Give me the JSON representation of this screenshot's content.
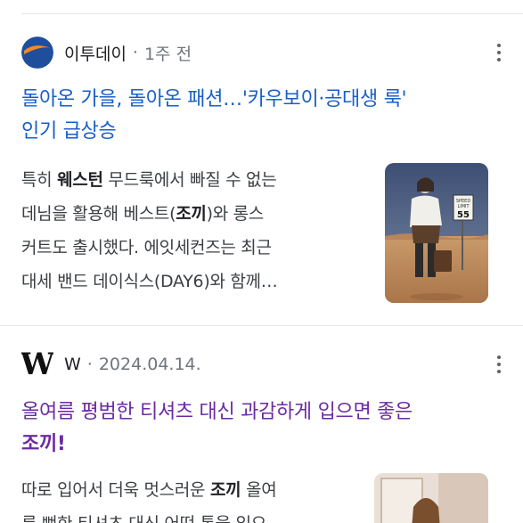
{
  "results": [
    {
      "source": {
        "name": "이투데이",
        "time": "1주 전",
        "logo_icon": "etoday-logo-icon"
      },
      "title_lines": [
        "돌아온 가을, 돌아온 패션…'카우보이·공대생 룩'",
        "인기 급상승"
      ],
      "snippet": {
        "l1_a": "특히 ",
        "l1_b": "웨스턴",
        "l1_c": " 무드룩에서 빠질 수 없는",
        "l2_a": "데님을 활용해 베스트(",
        "l2_b": "조끼",
        "l2_c": ")와 롱스",
        "l3": "커트도 출시했다. 에잇세컨즈는 최근",
        "l4": "대세 밴드 데이식스(DAY6)와 함께…"
      },
      "thumbnail": {
        "sign_l1": "SPEED",
        "sign_l2": "LIMIT",
        "sign_l3": "55"
      },
      "title_color": "#1a5ec8"
    },
    {
      "source": {
        "name": "W",
        "time": "2024.04.14.",
        "logo_icon": "w-magazine-logo-icon",
        "logo_text": "W"
      },
      "title_lines": [
        "올여름 평범한 티셔츠 대신 과감하게 입으면 좋은",
        "조끼!"
      ],
      "snippet": {
        "l1_a": "따로 입어서 더욱 멋스러운 ",
        "l1_b": "조끼",
        "l1_c": " 올여",
        "l2": "름 뻔한 티셔츠 대신 어떤 통을 입으"
      },
      "title_color": "#6b2ba1"
    }
  ],
  "more_icon": "more-vert-icon"
}
